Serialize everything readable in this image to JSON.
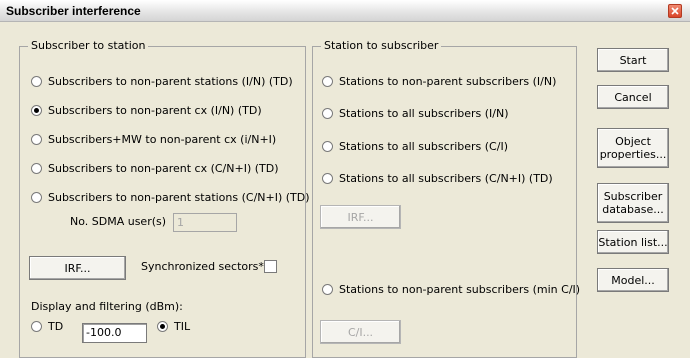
{
  "window": {
    "title": "Subscriber interference"
  },
  "subscriber_to_station": {
    "group_label": "Subscriber to station",
    "options": [
      {
        "label": "Subscribers to non-parent stations (I/N) (TD)",
        "checked": false
      },
      {
        "label": "Subscribers to non-parent cx (I/N) (TD)",
        "checked": true
      },
      {
        "label": "Subscribers+MW to non-parent cx (i/N+I)",
        "checked": false
      },
      {
        "label": "Subscribers to non-parent cx (C/N+I) (TD)",
        "checked": false
      },
      {
        "label": "Subscribers to non-parent stations (C/N+I) (TD)",
        "checked": false
      }
    ],
    "sdma_label": "No. SDMA user(s)",
    "sdma_value": "1",
    "irf_button": "IRF...",
    "sync_label": "Synchronized sectors*",
    "sync_checked": false,
    "display_label": "Display and filtering (dBm):",
    "td_label": "TD",
    "til_label": "TIL",
    "filter_value": "-100.0",
    "filter_mode": "TIL"
  },
  "station_to_subscriber": {
    "group_label": "Station to subscriber",
    "options": [
      {
        "label": "Stations to non-parent subscribers (I/N)",
        "checked": false
      },
      {
        "label": "Stations to all subscribers (I/N)",
        "checked": false
      },
      {
        "label": "Stations to all subscribers (C/I)",
        "checked": false
      },
      {
        "label": "Stations to all subscribers (C/N+I) (TD)",
        "checked": false
      }
    ],
    "irf_button": "IRF...",
    "min_ci_option": {
      "label": "Stations to non-parent subscribers (min C/I)",
      "checked": false
    },
    "ci_button": "C/I..."
  },
  "buttons": {
    "start": "Start",
    "cancel": "Cancel",
    "object_properties_line1": "Object",
    "object_properties_line2": "properties...",
    "subscriber_database_line1": "Subscriber",
    "subscriber_database_line2": "database...",
    "station_list": "Station list...",
    "model": "Model..."
  }
}
